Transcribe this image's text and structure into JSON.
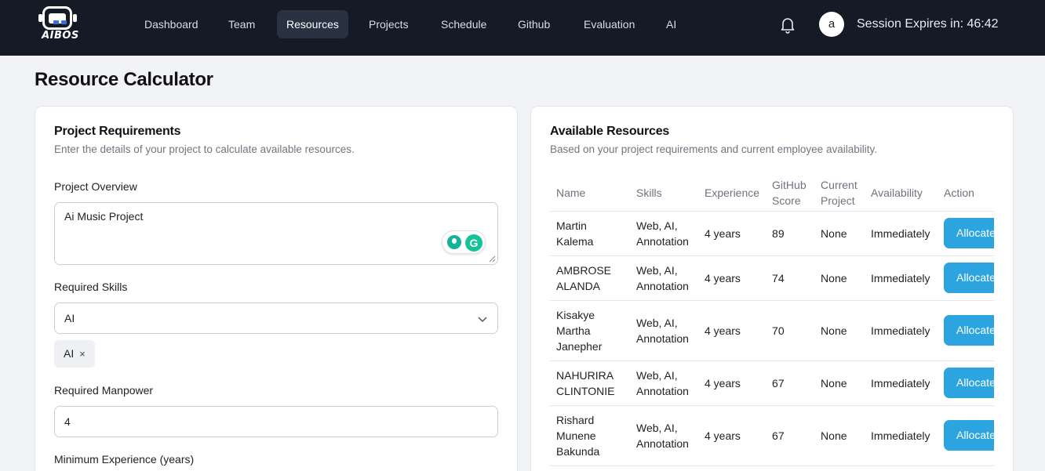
{
  "brand": {
    "name": "AIBOS"
  },
  "nav": {
    "items": [
      {
        "label": "Dashboard",
        "active": false
      },
      {
        "label": "Team",
        "active": false
      },
      {
        "label": "Resources",
        "active": true
      },
      {
        "label": "Projects",
        "active": false
      },
      {
        "label": "Schedule",
        "active": false
      },
      {
        "label": "Github",
        "active": false
      },
      {
        "label": "Evaluation",
        "active": false
      },
      {
        "label": "AI",
        "active": false
      }
    ],
    "avatar_initial": "a",
    "session_text": "Session Expires in: 46:42"
  },
  "page": {
    "title": "Resource Calculator"
  },
  "requirements": {
    "title": "Project Requirements",
    "subtitle": "Enter the details of your project to calculate available resources.",
    "overview_label": "Project Overview",
    "overview_value": "Ai Music Project",
    "skills_label": "Required Skills",
    "skills_selected": "AI",
    "skill_chip": "AI",
    "skill_chip_remove": "×",
    "manpower_label": "Required Manpower",
    "manpower_value": "4",
    "experience_label": "Minimum Experience (years)"
  },
  "resources": {
    "title": "Available Resources",
    "subtitle": "Based on your project requirements and current employee availability.",
    "columns": {
      "name": "Name",
      "skills": "Skills",
      "experience": "Experience",
      "github": "GitHub Score",
      "current": "Current Project",
      "availability": "Availability",
      "action": "Action"
    },
    "rows": [
      {
        "name": "Martin Kalema",
        "skills": "Web, AI, Annotation",
        "experience": "4 years",
        "github": "89",
        "current": "None",
        "availability": "Immediately",
        "action": "Allocate"
      },
      {
        "name": "AMBROSE ALANDA",
        "skills": "Web, AI, Annotation",
        "experience": "4 years",
        "github": "74",
        "current": "None",
        "availability": "Immediately",
        "action": "Allocate"
      },
      {
        "name": "Kisakye Martha Janepher",
        "skills": "Web, AI, Annotation",
        "experience": "4 years",
        "github": "70",
        "current": "None",
        "availability": "Immediately",
        "action": "Allocate"
      },
      {
        "name": "NAHURIRA CLINTONIE",
        "skills": "Web, AI, Annotation",
        "experience": "4 years",
        "github": "67",
        "current": "None",
        "availability": "Immediately",
        "action": "Allocate"
      },
      {
        "name": "Rishard Munene Bakunda",
        "skills": "Web, AI, Annotation",
        "experience": "4 years",
        "github": "67",
        "current": "None",
        "availability": "Immediately",
        "action": "Allocate"
      }
    ]
  }
}
